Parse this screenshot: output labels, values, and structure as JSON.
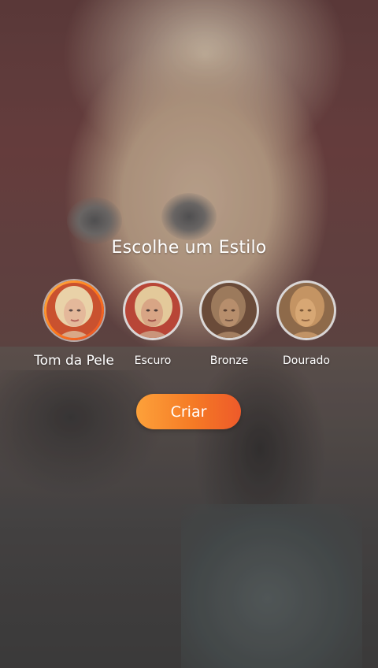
{
  "screen": {
    "title": "Escolhe um Estilo"
  },
  "styles": [
    {
      "label": "Tom da Pele",
      "selected": true,
      "swatch": "#e4b89a",
      "bg": "#c9512f",
      "hair": "#e9d2a8"
    },
    {
      "label": "Escuro",
      "selected": false,
      "swatch": "#d8a585",
      "bg": "#b84637",
      "hair": "#e3c99a"
    },
    {
      "label": "Bronze",
      "selected": false,
      "swatch": "#b78e6c",
      "bg": "#6a4b39",
      "hair": "#9c7a5c"
    },
    {
      "label": "Dourado",
      "selected": false,
      "swatch": "#d7a774",
      "bg": "#8e6a4a",
      "hair": "#c49463"
    }
  ],
  "actions": {
    "create_label": "Criar"
  },
  "colors": {
    "accent_start": "#fda13a",
    "accent_end": "#ee5a2a"
  }
}
